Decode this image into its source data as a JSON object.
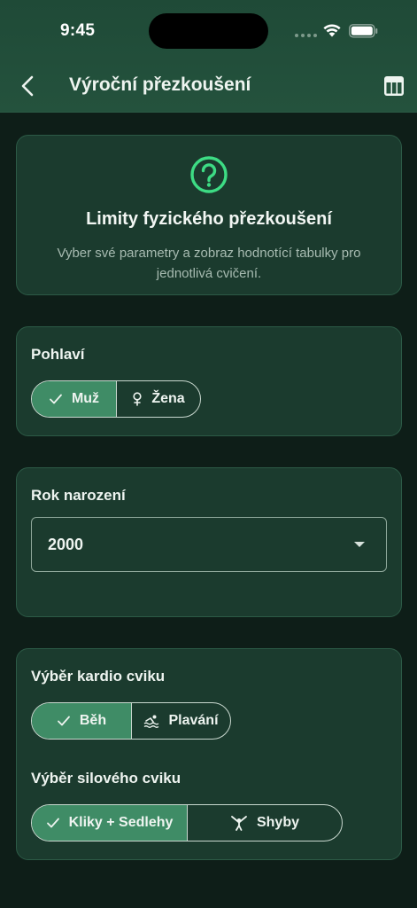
{
  "status_bar": {
    "time": "9:45"
  },
  "app_bar": {
    "title": "Výroční přezkoušení",
    "back_icon": "chevron-left-icon",
    "action_icon": "table-icon"
  },
  "info_card": {
    "icon": "help-circle-icon",
    "title": "Limity fyzického přezkoušení",
    "description": "Vyber své parametry a zobraz hodnotící tabulky pro jednotlivá cvičení."
  },
  "gender": {
    "label": "Pohlaví",
    "options": [
      {
        "label": "Muž",
        "icon": "check-icon",
        "selected": true
      },
      {
        "label": "Žena",
        "icon": "female-icon",
        "selected": false
      }
    ]
  },
  "birth_year": {
    "label": "Rok narození",
    "value": "2000"
  },
  "cardio": {
    "label": "Výběr kardio cviku",
    "options": [
      {
        "label": "Běh",
        "icon": "check-icon",
        "selected": true
      },
      {
        "label": "Plavání",
        "icon": "swimming-icon",
        "selected": false
      }
    ]
  },
  "strength": {
    "label": "Výběr silového cviku",
    "options": [
      {
        "label": "Kliky + Sedlehy",
        "icon": "check-icon",
        "selected": true
      },
      {
        "label": "Shyby",
        "icon": "gymnastics-icon",
        "selected": false
      }
    ]
  },
  "colors": {
    "accent": "#3f8c66",
    "icon_accent": "#3ddc84",
    "card": "#1b3b2e",
    "background": "#0e1e18"
  }
}
